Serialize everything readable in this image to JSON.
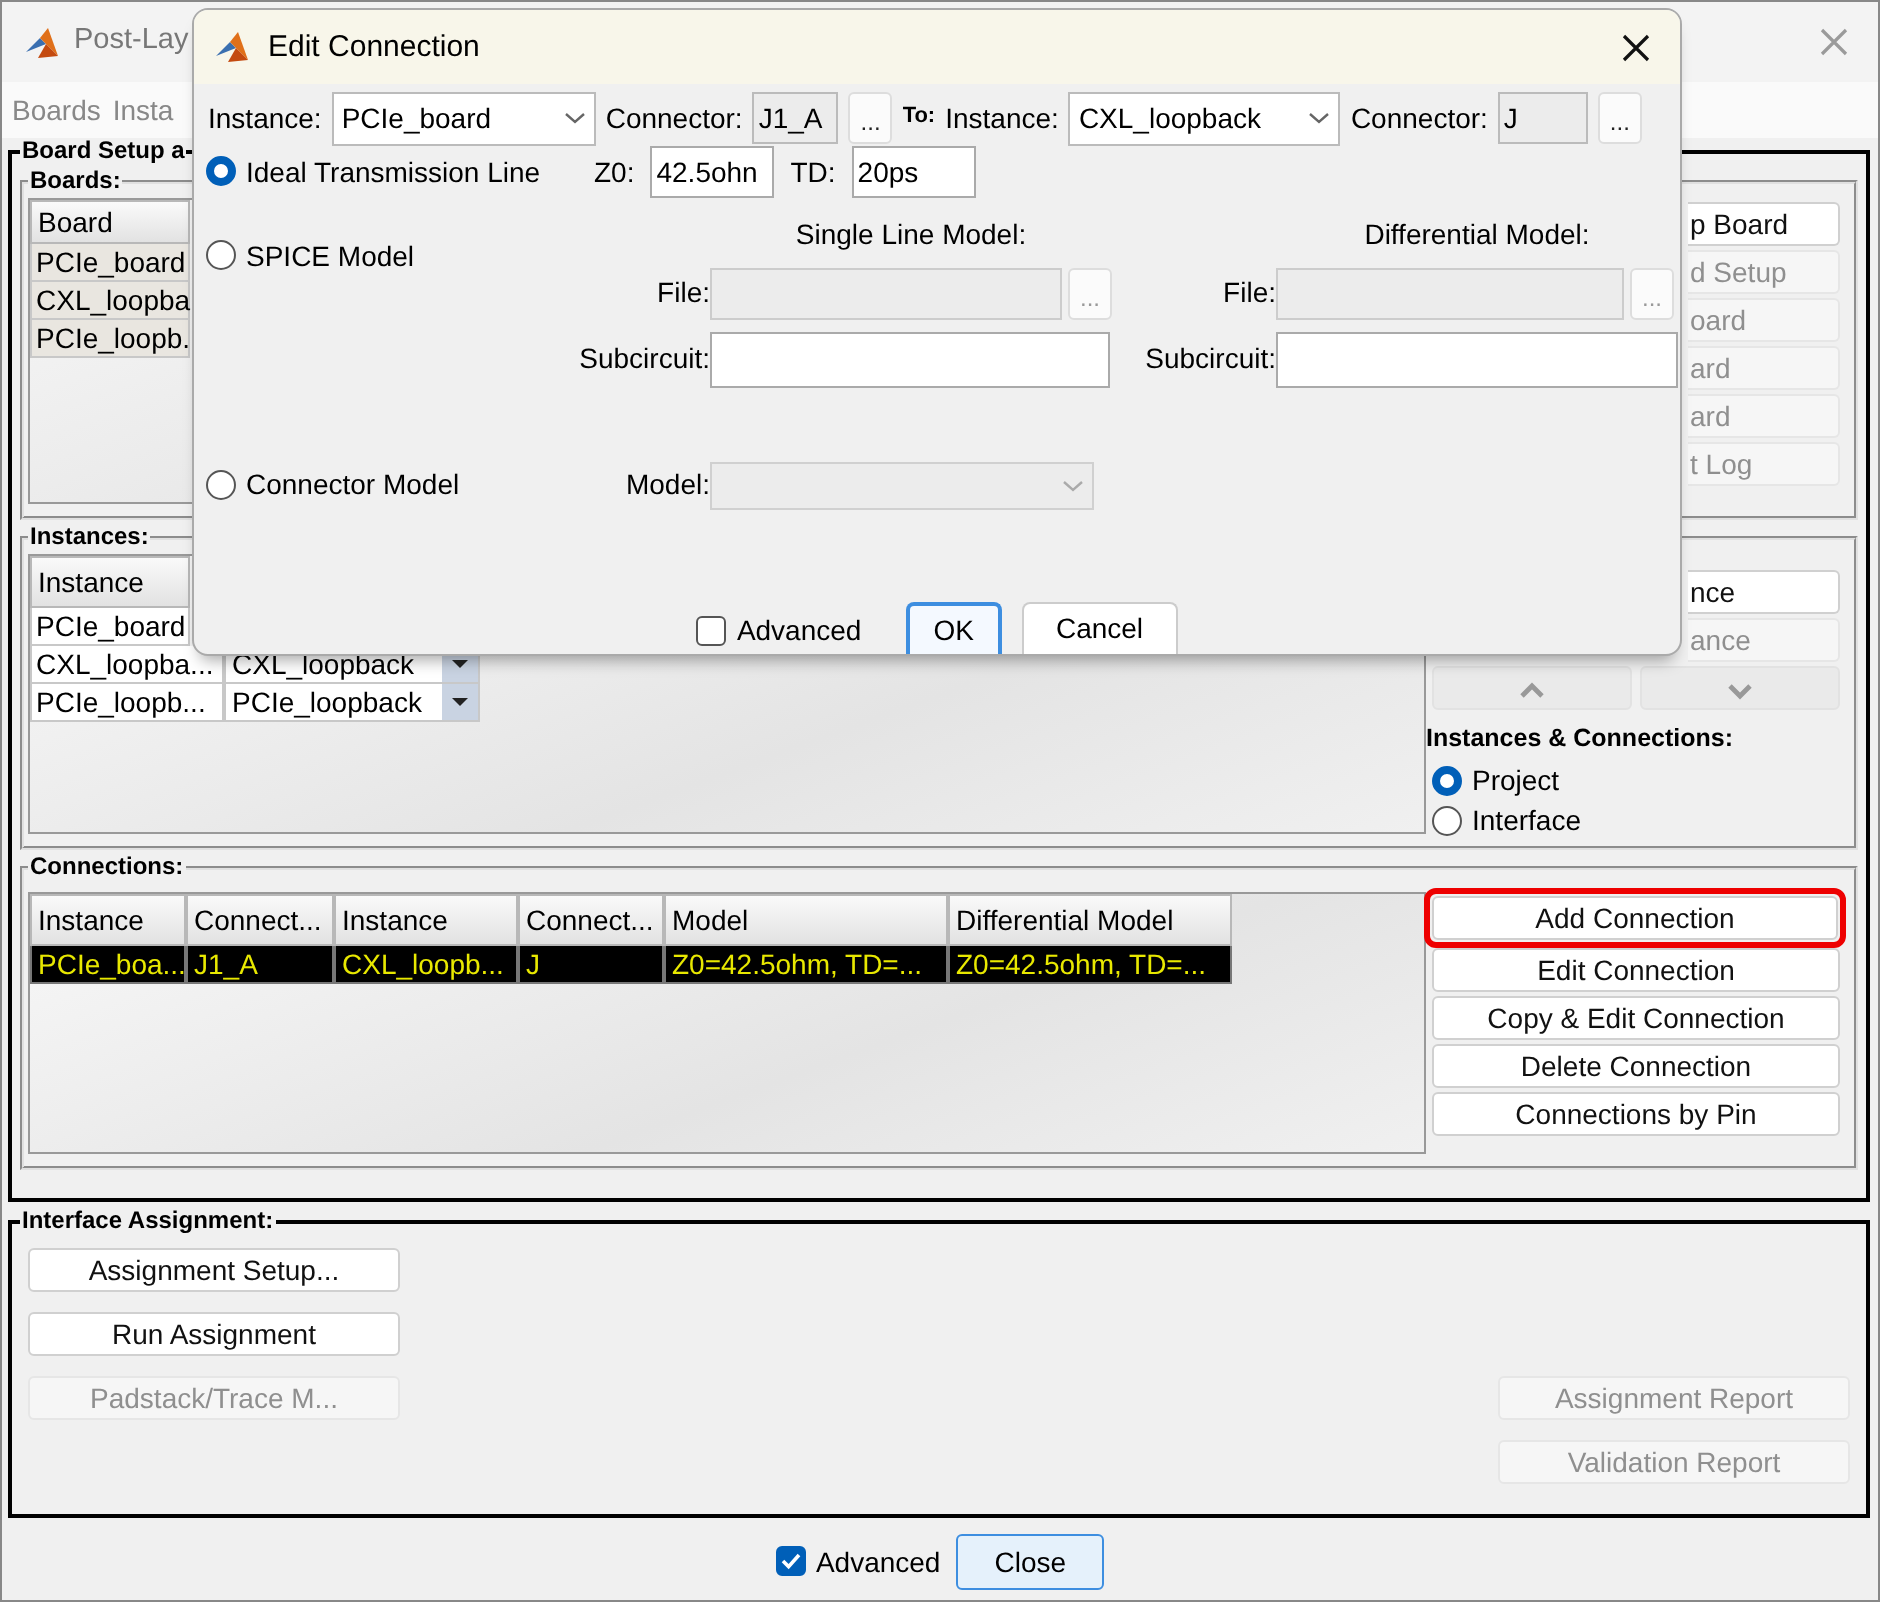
{
  "main_window": {
    "title": "Post-Lay",
    "menu": [
      "Boards",
      "Insta"
    ],
    "board_setup": {
      "title": "Board Setup a",
      "boards": {
        "title": "Boards:",
        "columns": [
          "Board"
        ],
        "rows": [
          "PCIe_board",
          "CXL_loopba",
          "PCIe_loopb."
        ],
        "buttons": [
          {
            "label": "p Board",
            "disabled": false
          },
          {
            "label": "d Setup",
            "disabled": true
          },
          {
            "label": "oard",
            "disabled": true
          },
          {
            "label": "ard",
            "disabled": true
          },
          {
            "label": "ard",
            "disabled": true
          },
          {
            "label": "t Log",
            "disabled": true
          }
        ]
      },
      "instances": {
        "title": "Instances:",
        "columns": [
          "Instance"
        ],
        "rows": [
          {
            "instance": "PCIe_board"
          },
          {
            "instance": "CXL_loopba...",
            "board": "CXL_loopback"
          },
          {
            "instance": "PCIe_loopb...",
            "board": "PCIe_loopback"
          }
        ],
        "buttons": [
          {
            "label": "nce",
            "disabled": false
          },
          {
            "label": "ance",
            "disabled": true
          }
        ],
        "scope": {
          "title": "Instances & Connections:",
          "options": [
            {
              "label": "Project",
              "selected": true
            },
            {
              "label": "Interface",
              "selected": false
            }
          ]
        }
      },
      "connections": {
        "title": "Connections:",
        "columns": [
          "Instance",
          "Connect...",
          "Instance",
          "Connect...",
          "Model",
          "Differential Model"
        ],
        "rows": [
          {
            "cells": [
              "PCIe_boa...",
              "J1_A",
              "CXL_loopb...",
              "J",
              "Z0=42.5ohm, TD=...",
              "Z0=42.5ohm, TD=..."
            ],
            "selected": true
          }
        ],
        "buttons": [
          {
            "label": "Add Connection",
            "disabled": false,
            "highlighted": true
          },
          {
            "label": "Edit Connection",
            "disabled": false,
            "highlighted": false
          },
          {
            "label": "Copy & Edit Connection",
            "disabled": false,
            "highlighted": false
          },
          {
            "label": "Delete Connection",
            "disabled": false,
            "highlighted": false
          },
          {
            "label": "Connections by Pin",
            "disabled": false,
            "highlighted": false
          }
        ]
      }
    },
    "interface_assignment": {
      "title": "Interface Assignment:",
      "left_buttons": [
        {
          "label": "Assignment Setup...",
          "disabled": false
        },
        {
          "label": "Run Assignment",
          "disabled": false
        },
        {
          "label": "Padstack/Trace M...",
          "disabled": true
        }
      ],
      "right_buttons": [
        {
          "label": "Assignment Report",
          "disabled": true
        },
        {
          "label": "Validation Report",
          "disabled": true
        }
      ]
    },
    "footer": {
      "advanced": {
        "label": "Advanced",
        "checked": true
      },
      "close_button": "Close"
    }
  },
  "dialog": {
    "title": "Edit Connection",
    "from": {
      "instance_label": "Instance:",
      "instance": "PCIe_board",
      "connector_label": "Connector:",
      "connector": "J1_A",
      "browse": "..."
    },
    "to_label": "To:",
    "to": {
      "instance_label": "Instance:",
      "instance": "CXL_loopback",
      "connector_label": "Connector:",
      "connector": "J",
      "browse": "..."
    },
    "models": [
      {
        "label": "Ideal Transmission Line",
        "selected": true
      },
      {
        "label": "SPICE Model",
        "selected": false
      },
      {
        "label": "Connector Model",
        "selected": false
      }
    ],
    "ideal": {
      "z0_label": "Z0:",
      "z0": "42.5ohn",
      "td_label": "TD:",
      "td": "20ps"
    },
    "single_line": {
      "title": "Single Line Model:",
      "file_label": "File:",
      "browse": "...",
      "subcircuit_label": "Subcircuit:"
    },
    "differential": {
      "title": "Differential Model:",
      "file_label": "File:",
      "browse": "...",
      "subcircuit_label": "Subcircuit:"
    },
    "connector_model": {
      "model_label": "Model:"
    },
    "advanced": {
      "label": "Advanced",
      "checked": false
    },
    "buttons": [
      "OK",
      "Cancel"
    ]
  }
}
